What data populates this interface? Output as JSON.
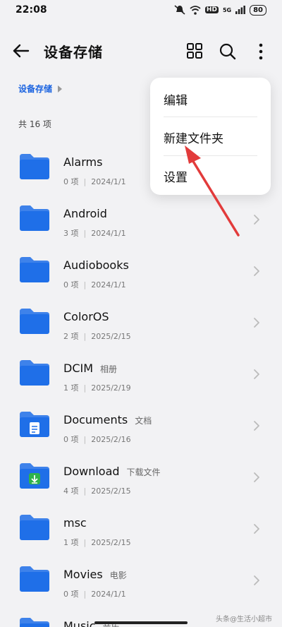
{
  "status_bar": {
    "time": "22:08",
    "hd_label": "HD",
    "signal_label": "5G",
    "battery": "80"
  },
  "app_bar": {
    "title": "设备存储"
  },
  "breadcrumb": {
    "current": "设备存储"
  },
  "summary": {
    "count_text": "共 16 项"
  },
  "files": [
    {
      "name": "Alarms",
      "alias": "",
      "items": "0 项",
      "date": "2024/1/1",
      "badge": ""
    },
    {
      "name": "Android",
      "alias": "",
      "items": "3 项",
      "date": "2024/1/1",
      "badge": ""
    },
    {
      "name": "Audiobooks",
      "alias": "",
      "items": "0 项",
      "date": "2024/1/1",
      "badge": ""
    },
    {
      "name": "ColorOS",
      "alias": "",
      "items": "2 项",
      "date": "2025/2/15",
      "badge": ""
    },
    {
      "name": "DCIM",
      "alias": "相册",
      "items": "1 项",
      "date": "2025/2/19",
      "badge": ""
    },
    {
      "name": "Documents",
      "alias": "文档",
      "items": "0 项",
      "date": "2025/2/16",
      "badge": "document-icon"
    },
    {
      "name": "Download",
      "alias": "下载文件",
      "items": "4 项",
      "date": "2025/2/15",
      "badge": "download-icon"
    },
    {
      "name": "msc",
      "alias": "",
      "items": "1 项",
      "date": "2025/2/15",
      "badge": ""
    },
    {
      "name": "Movies",
      "alias": "电影",
      "items": "0 项",
      "date": "2024/1/1",
      "badge": ""
    },
    {
      "name": "Music",
      "alias": "音乐",
      "items": "",
      "date": "",
      "badge": ""
    }
  ],
  "menu": {
    "items": [
      "编辑",
      "新建文件夹",
      "设置"
    ]
  },
  "watermark": "头条@生活小超市",
  "colors": {
    "accent": "#1a63e0",
    "folder": "#1f6fe8",
    "arrow": "#e23b3b",
    "download_badge": "#2fb34a"
  }
}
